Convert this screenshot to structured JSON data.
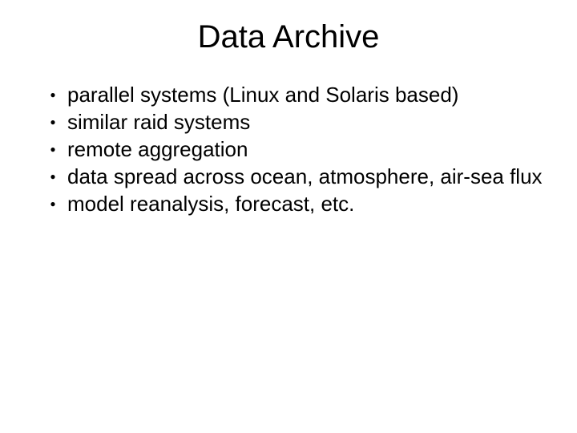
{
  "title": "Data Archive",
  "bullet_glyph": "●",
  "items": [
    "parallel systems (Linux and Solaris based)",
    "similar raid systems",
    "remote aggregation",
    "data spread across ocean, atmosphere, air-sea flux",
    "model reanalysis, forecast, etc."
  ]
}
